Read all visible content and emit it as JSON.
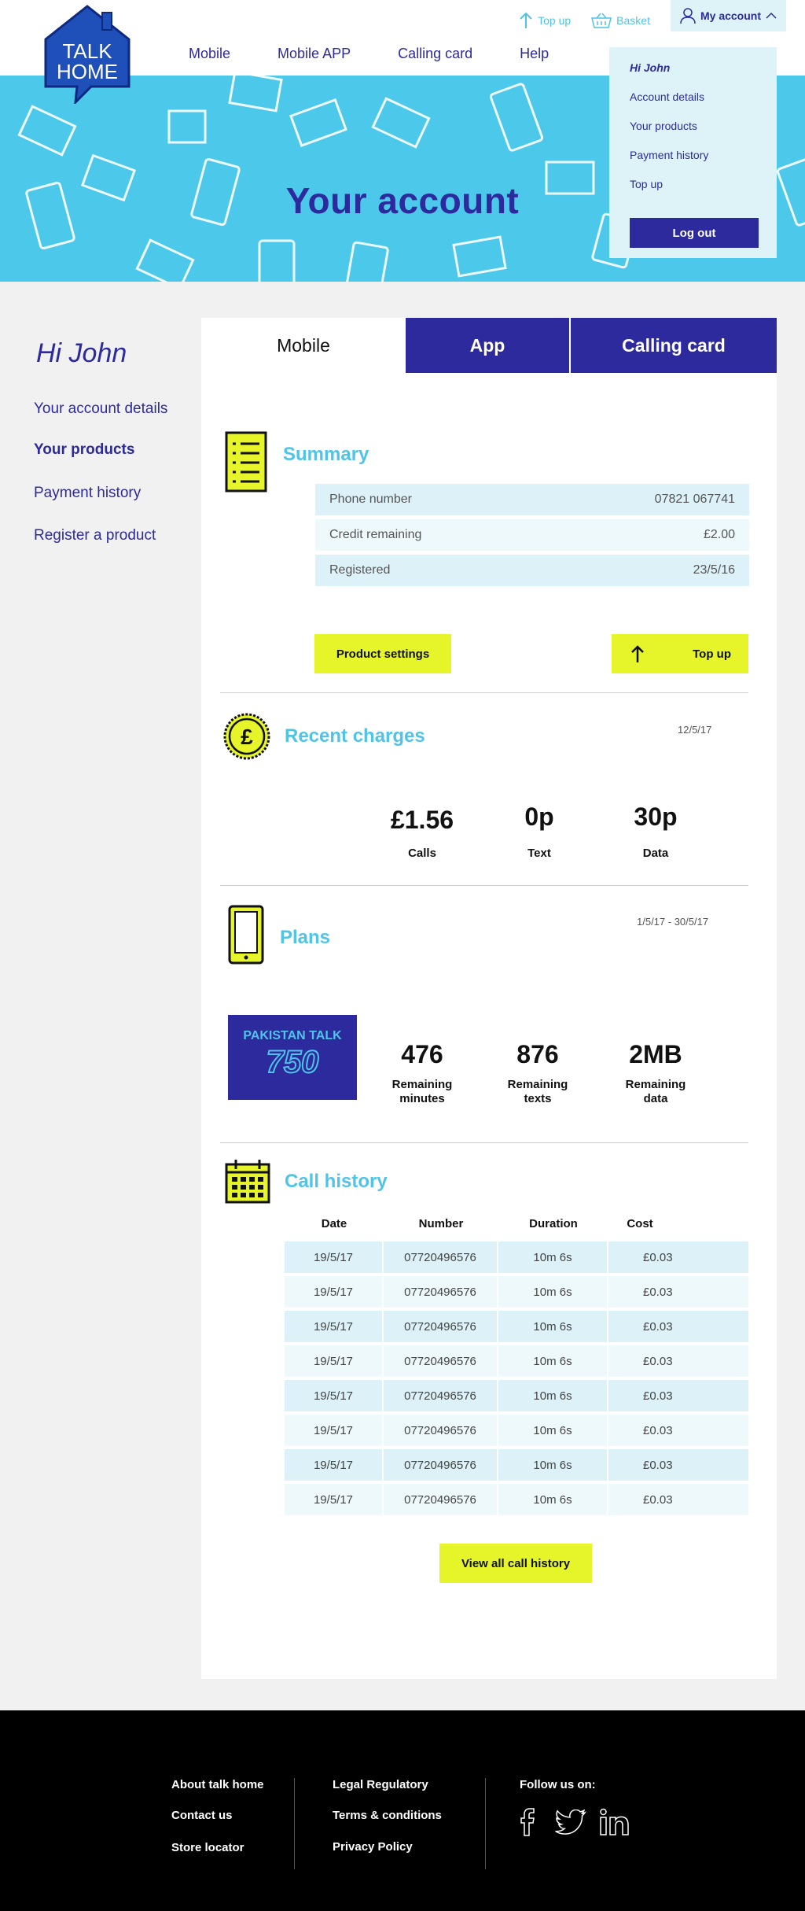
{
  "brand": {
    "logo_line1": "TALK",
    "logo_line2": "HOME"
  },
  "nav": {
    "items": [
      "Mobile",
      "Mobile APP",
      "Calling card",
      "Help"
    ]
  },
  "utility": {
    "topup": "Top up",
    "basket": "Basket",
    "account": "My account"
  },
  "hero": {
    "title": "Your account"
  },
  "dropdown": {
    "name": "Hi John",
    "links": [
      "Account details",
      "Your products",
      "Payment history",
      "Top up"
    ],
    "logout": "Log out"
  },
  "sidebar": {
    "greeting": "Hi John",
    "links": [
      "Your account details",
      "Your products",
      "Payment history",
      "Register a product"
    ]
  },
  "tabs": [
    "Mobile",
    "App",
    "Calling card"
  ],
  "summary": {
    "title": "Summary",
    "rows": [
      {
        "label": "Phone number",
        "value": "07821 067741"
      },
      {
        "label": "Credit remaining",
        "value": "£2.00"
      },
      {
        "label": "Registered",
        "value": "23/5/16"
      }
    ],
    "settings_btn": "Product settings",
    "topup_btn": "Top up"
  },
  "charges": {
    "title": "Recent charges",
    "date": "12/5/17",
    "items": [
      {
        "value": "£1.56",
        "label": "Calls"
      },
      {
        "value": "0p",
        "label": "Text"
      },
      {
        "value": "30p",
        "label": "Data"
      }
    ]
  },
  "plans": {
    "title": "Plans",
    "date": "1/5/17 - 30/5/17",
    "plan_name": "PAKISTAN TALK",
    "plan_number": "750",
    "items": [
      {
        "value": "476",
        "label1": "Remaining",
        "label2": "minutes"
      },
      {
        "value": "876",
        "label1": "Remaining",
        "label2": "texts"
      },
      {
        "value": "2MB",
        "label1": "Remaining",
        "label2": "data"
      }
    ]
  },
  "call_history": {
    "title": "Call history",
    "headers": [
      "Date",
      "Number",
      "Duration",
      "Cost"
    ],
    "rows": [
      [
        "19/5/17",
        "07720496576",
        "10m 6s",
        "£0.03"
      ],
      [
        "19/5/17",
        "07720496576",
        "10m 6s",
        "£0.03"
      ],
      [
        "19/5/17",
        "07720496576",
        "10m 6s",
        "£0.03"
      ],
      [
        "19/5/17",
        "07720496576",
        "10m 6s",
        "£0.03"
      ],
      [
        "19/5/17",
        "07720496576",
        "10m 6s",
        "£0.03"
      ],
      [
        "19/5/17",
        "07720496576",
        "10m 6s",
        "£0.03"
      ],
      [
        "19/5/17",
        "07720496576",
        "10m 6s",
        "£0.03"
      ],
      [
        "19/5/17",
        "07720496576",
        "10m 6s",
        "£0.03"
      ]
    ],
    "view_all": "View all call history"
  },
  "footer": {
    "col1": [
      "About talk home",
      "Contact us",
      "Store locator"
    ],
    "col2": [
      "Legal Regulatory",
      "Terms & conditions",
      "Privacy Policy"
    ],
    "follow": "Follow us on:"
  },
  "colors": {
    "navy": "#2c2a9c",
    "cyan": "#4cc9ea",
    "yellow": "#e6f52a"
  }
}
